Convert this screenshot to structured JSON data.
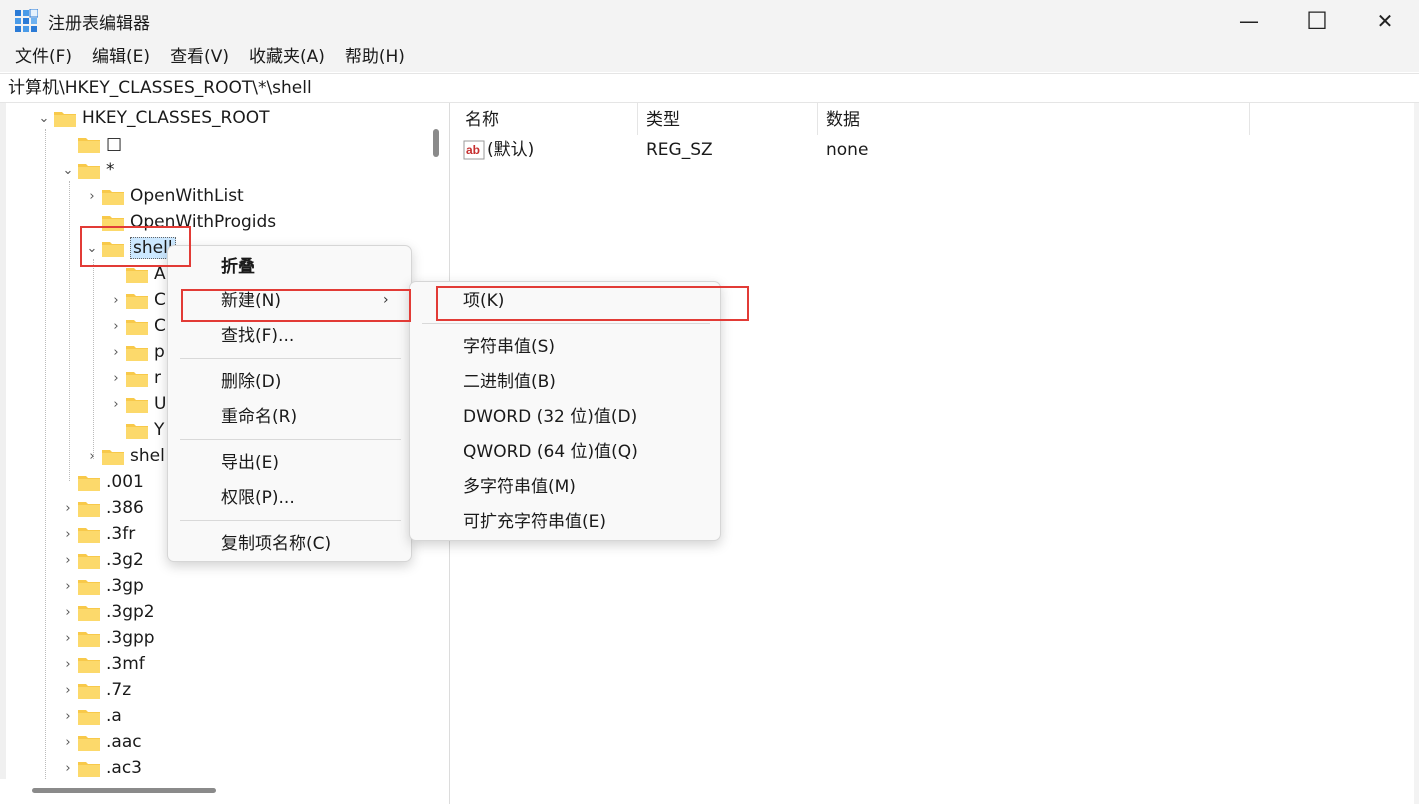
{
  "window": {
    "title": "注册表编辑器",
    "min_label": "—",
    "max_label": "☐",
    "close_label": "✕"
  },
  "menubar": {
    "items": [
      "文件(F)",
      "编辑(E)",
      "查看(V)",
      "收藏夹(A)",
      "帮助(H)"
    ]
  },
  "address": "计算机\\HKEY_CLASSES_ROOT\\*\\shell",
  "tree": {
    "root": "HKEY_CLASSES_ROOT",
    "box_key": "□",
    "star_key": "*",
    "star_children": [
      "OpenWithList",
      "OpenWithProgids",
      "shell"
    ],
    "shell_children": [
      "A",
      "C",
      "C",
      "p",
      "r",
      "U",
      "Y"
    ],
    "shellex": "shel",
    "root_children": [
      ".001",
      ".386",
      ".3fr",
      ".3g2",
      ".3gp",
      ".3gp2",
      ".3gpp",
      ".3mf",
      ".7z",
      ".a",
      ".aac",
      ".ac3"
    ]
  },
  "list": {
    "columns": [
      "名称",
      "类型",
      "数据"
    ],
    "rows": [
      {
        "name": "(默认)",
        "type": "REG_SZ",
        "data": "none"
      }
    ]
  },
  "context_menu": {
    "collapse": "折叠",
    "new": "新建(N)",
    "find": "查找(F)...",
    "delete": "删除(D)",
    "rename": "重命名(R)",
    "export": "导出(E)",
    "permissions": "权限(P)...",
    "copy_key_name": "复制项名称(C)"
  },
  "submenu": {
    "key": "项(K)",
    "string": "字符串值(S)",
    "binary": "二进制值(B)",
    "dword": "DWORD (32 位)值(D)",
    "qword": "QWORD (64 位)值(Q)",
    "multi_string": "多字符串值(M)",
    "expand_string": "可扩充字符串值(E)"
  },
  "colors": {
    "highlight_box": "#e23b36",
    "folder": "#f8c94a",
    "selection": "#cce8ff"
  }
}
